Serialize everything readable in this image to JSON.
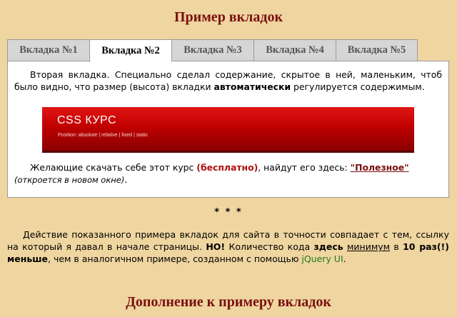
{
  "page_title": "Пример вкладок",
  "tabs": [
    {
      "label": "Вкладка №1"
    },
    {
      "label": "Вкладка №2"
    },
    {
      "label": "Вкладка №3"
    },
    {
      "label": "Вкладка №4"
    },
    {
      "label": "Вкладка №5"
    }
  ],
  "active_tab": "Вкладка №2",
  "panel": {
    "intro_1": "Вторая вкладка. Специально сделал содержание, скрытое в ней, маленьким, чтоб было видно, что размер (высота) вкладки ",
    "intro_bold": "автоматически",
    "intro_2": " регулируется содержимым.",
    "banner_title": "CSS КУРС",
    "banner_subtitle": "Position: absolute | relative | fixed | static",
    "download_1": "Желающие скачать себе этот курс ",
    "download_free": "(бесплатно)",
    "download_2": ", найдут его здесь: ",
    "download_link": "\"Полезное\"",
    "download_note": "(откроется в новом окне)",
    "download_end": "."
  },
  "separator": "* * *",
  "bottom": {
    "p1": "Действие показанного примера вкладок для сайта в точности совпадает с тем, ссылку на который я давал в начале страницы. ",
    "no": "НО!",
    "p2": " Количество кода ",
    "here": "здесь",
    "space": " ",
    "minimum": "минимум",
    "p3": " в ",
    "times": "10 раз(!) меньше",
    "p4": ", чем в аналогичном примере, созданном с помощью ",
    "jquery": "jQuery UI",
    "p5": "."
  },
  "section_title": "Дополнение к примеру вкладок",
  "colors": {
    "background": "#efd5a0",
    "heading": "#7a1010",
    "banner": "#c00000",
    "jquery_link": "#1f7a1f"
  }
}
